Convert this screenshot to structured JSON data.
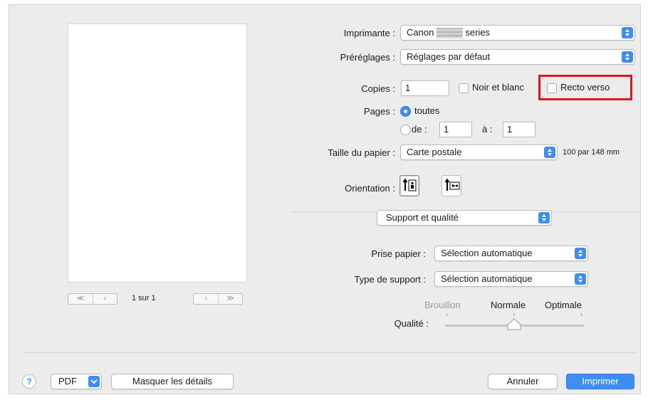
{
  "printer": {
    "label": "Imprimante :",
    "value": "Canon ▒▒▒▒ series"
  },
  "presets": {
    "label": "Préréglages :",
    "value": "Réglages par défaut"
  },
  "copies": {
    "label": "Copies :",
    "value": "1",
    "bw_label": "Noir et blanc",
    "duplex_label": "Recto verso"
  },
  "pages": {
    "label": "Pages :",
    "all_label": "toutes",
    "from_label": "de :",
    "from_value": "1",
    "to_label": "à :",
    "to_value": "1"
  },
  "paper_size": {
    "label": "Taille du papier :",
    "value": "Carte postale",
    "dimensions": "100 par 148 mm"
  },
  "orientation": {
    "label": "Orientation :"
  },
  "section": {
    "value": "Support et qualité"
  },
  "paper_feed": {
    "label": "Prise papier :",
    "value": "Sélection automatique"
  },
  "media_type": {
    "label": "Type de support :",
    "value": "Sélection automatique"
  },
  "quality": {
    "label": "Qualité :",
    "draft": "Brouillon",
    "normal": "Normale",
    "best": "Optimale"
  },
  "preview": {
    "page_indicator": "1 sur 1"
  },
  "footer": {
    "help": "?",
    "pdf": "PDF",
    "hide_details": "Masquer les détails",
    "cancel": "Annuler",
    "print": "Imprimer"
  },
  "colors": {
    "accent": "#3d8ef0",
    "highlight_box": "#e3151a"
  }
}
